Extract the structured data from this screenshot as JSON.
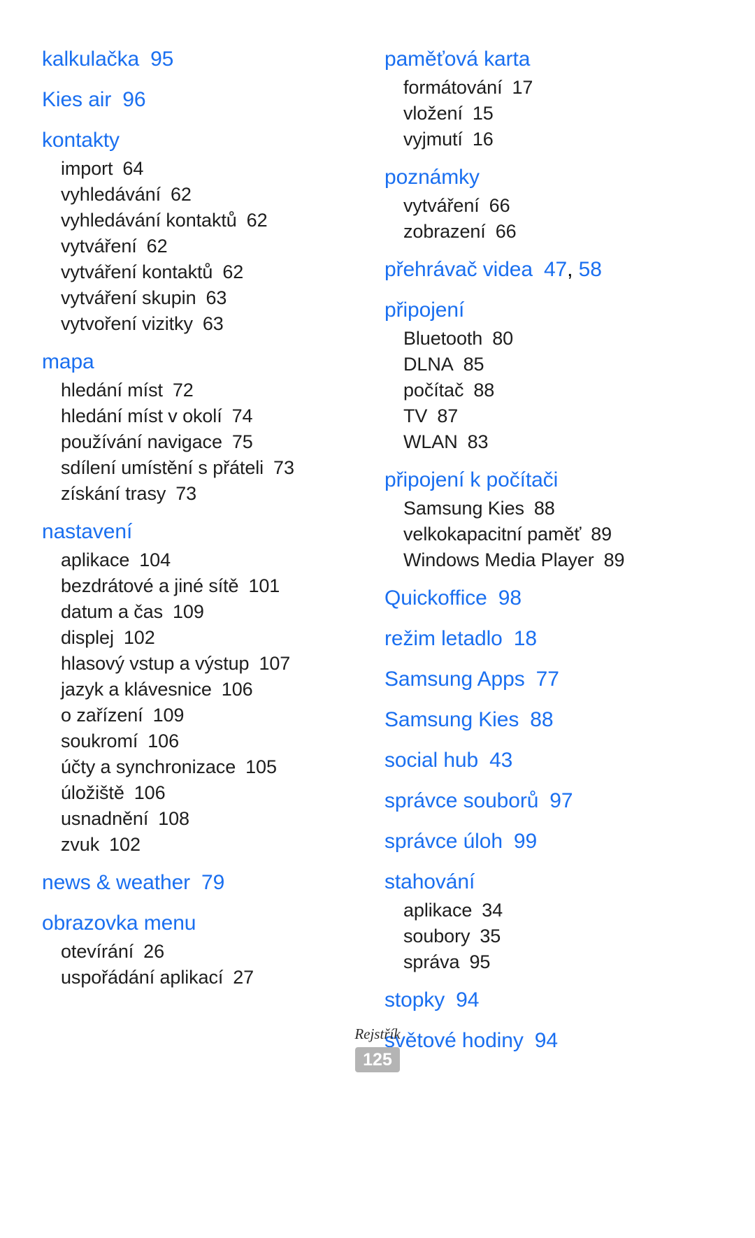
{
  "document": {
    "footer_label": "Rejstřík",
    "page_number": "125",
    "heading_color": "#1a6ff0",
    "body_color": "#1d1d1d",
    "page_badge_color": "#b4b4b4"
  },
  "columns": [
    {
      "name": "left-column",
      "groups": [
        {
          "heading": "kalkulačka",
          "heading_page": "95",
          "entries": []
        },
        {
          "heading": "Kies air",
          "heading_page": "96",
          "entries": []
        },
        {
          "heading": "kontakty",
          "heading_page": "",
          "entries": [
            {
              "label": "import",
              "page": "64"
            },
            {
              "label": "vyhledávání",
              "page": "62"
            },
            {
              "label": "vyhledávání kontaktů",
              "page": "62"
            },
            {
              "label": "vytváření",
              "page": "62"
            },
            {
              "label": "vytváření kontaktů",
              "page": "62"
            },
            {
              "label": "vytváření skupin",
              "page": "63"
            },
            {
              "label": "vytvoření vizitky",
              "page": "63"
            }
          ]
        },
        {
          "heading": "mapa",
          "heading_page": "",
          "entries": [
            {
              "label": "hledání míst",
              "page": "72"
            },
            {
              "label": "hledání míst v okolí",
              "page": "74"
            },
            {
              "label": "používání navigace",
              "page": "75"
            },
            {
              "label": "sdílení umístění s přáteli",
              "page": "73"
            },
            {
              "label": "získání trasy",
              "page": "73"
            }
          ]
        },
        {
          "heading": "nastavení",
          "heading_page": "",
          "entries": [
            {
              "label": "aplikace",
              "page": "104"
            },
            {
              "label": "bezdrátové a jiné sítě",
              "page": "101"
            },
            {
              "label": "datum a čas",
              "page": "109"
            },
            {
              "label": "displej",
              "page": "102"
            },
            {
              "label": "hlasový vstup a výstup",
              "page": "107"
            },
            {
              "label": "jazyk a klávesnice",
              "page": "106"
            },
            {
              "label": "o zařízení",
              "page": "109"
            },
            {
              "label": "soukromí",
              "page": "106"
            },
            {
              "label": "účty a synchronizace",
              "page": "105"
            },
            {
              "label": "úložiště",
              "page": "106"
            },
            {
              "label": "usnadnění",
              "page": "108"
            },
            {
              "label": "zvuk",
              "page": "102"
            }
          ]
        },
        {
          "heading": "news & weather",
          "heading_page": "79",
          "entries": []
        },
        {
          "heading": "obrazovka menu",
          "heading_page": "",
          "entries": [
            {
              "label": "otevírání",
              "page": "26"
            },
            {
              "label": "uspořádání aplikací",
              "page": "27"
            }
          ]
        }
      ]
    },
    {
      "name": "right-column",
      "groups": [
        {
          "heading": "paměťová karta",
          "heading_page": "",
          "entries": [
            {
              "label": "formátování",
              "page": "17"
            },
            {
              "label": "vložení",
              "page": "15"
            },
            {
              "label": "vyjmutí",
              "page": "16"
            }
          ]
        },
        {
          "heading": "poznámky",
          "heading_page": "",
          "entries": [
            {
              "label": "vytváření",
              "page": "66"
            },
            {
              "label": "zobrazení",
              "page": "66"
            }
          ]
        },
        {
          "heading": "přehrávač videa",
          "heading_page": "47, 58",
          "entries": []
        },
        {
          "heading": "připojení",
          "heading_page": "",
          "entries": [
            {
              "label": "Bluetooth",
              "page": "80"
            },
            {
              "label": "DLNA",
              "page": "85"
            },
            {
              "label": "počítač",
              "page": "88"
            },
            {
              "label": "TV",
              "page": "87"
            },
            {
              "label": "WLAN",
              "page": "83"
            }
          ]
        },
        {
          "heading": "připojení k počítači",
          "heading_page": "",
          "entries": [
            {
              "label": "Samsung Kies",
              "page": "88"
            },
            {
              "label": "velkokapacitní paměť",
              "page": "89"
            },
            {
              "label": "Windows Media Player",
              "page": "89"
            }
          ]
        },
        {
          "heading": "Quickoffice",
          "heading_page": "98",
          "entries": []
        },
        {
          "heading": "režim letadlo",
          "heading_page": "18",
          "entries": []
        },
        {
          "heading": "Samsung Apps",
          "heading_page": "77",
          "entries": []
        },
        {
          "heading": "Samsung Kies",
          "heading_page": "88",
          "entries": []
        },
        {
          "heading": "social hub",
          "heading_page": "43",
          "entries": []
        },
        {
          "heading": "správce souborů",
          "heading_page": "97",
          "entries": []
        },
        {
          "heading": "správce úloh",
          "heading_page": "99",
          "entries": []
        },
        {
          "heading": "stahování",
          "heading_page": "",
          "entries": [
            {
              "label": "aplikace",
              "page": "34"
            },
            {
              "label": "soubory",
              "page": "35"
            },
            {
              "label": "správa",
              "page": "95"
            }
          ]
        },
        {
          "heading": "stopky",
          "heading_page": "94",
          "entries": []
        },
        {
          "heading": "světové hodiny",
          "heading_page": "94",
          "entries": []
        }
      ]
    }
  ]
}
